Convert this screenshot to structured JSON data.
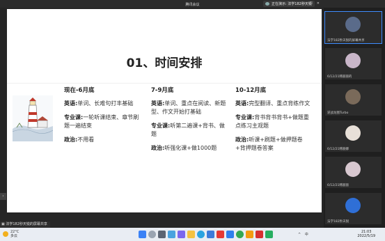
{
  "window": {
    "title": "腾讯会议",
    "sharing_status": "正在演示: 法学182秒天锐"
  },
  "slide": {
    "title": "01、时间安排",
    "columns": [
      {
        "head": "现在-6月底",
        "items": [
          {
            "label": "英语:",
            "text": "单词、长难句打丰基础"
          },
          {
            "label": "专业课:",
            "text": "一轮听课结束、章节刷题一遍结束"
          },
          {
            "label": "政治:",
            "text": "不用看"
          }
        ]
      },
      {
        "head": "7-9月底",
        "items": [
          {
            "label": "英语:",
            "text": "单词、重点在阅读、新题型、作文开始打基础"
          },
          {
            "label": "专业课:",
            "text": "听第二遍课+背书、做题"
          },
          {
            "label": "政治:",
            "text": "听强化课+做1000题"
          }
        ]
      },
      {
        "head": "10-12月底",
        "items": [
          {
            "label": "英语:",
            "text": "完型翻译、重点背练作文"
          },
          {
            "label": "专业课:",
            "text": "背书背书背书+做题重点练习主观题"
          },
          {
            "label": "政治:",
            "text": "听课+刷题+做押题卷+背押题卷答案"
          }
        ]
      }
    ]
  },
  "share_label": "法学182秒天锐的屏幕共享",
  "participants": [
    {
      "name": "法学182秒天锐的屏幕共享",
      "avatar_color": "#5a6b8a",
      "active": true
    },
    {
      "name": "6/12/21韩丽丽的",
      "avatar_color": "#c9b6c9",
      "active": false
    },
    {
      "name": "逆战龙图Turbo",
      "avatar_color": "#7a6a5a",
      "active": false
    },
    {
      "name": "6/12/21韩丽娜",
      "avatar_color": "#e8e0d8",
      "active": false
    },
    {
      "name": "6/12/21韩丽丽",
      "avatar_color": "#d8c8d0",
      "active": false
    },
    {
      "name": "法学182秒天锐",
      "avatar_color": "#2f6fd6",
      "active": false
    }
  ],
  "taskbar": {
    "weather_temp": "22°C",
    "weather_desc": "多云",
    "time": "21:03",
    "date": "2022/5/19",
    "tray_text": "^ 中"
  },
  "icons": {
    "taskbar_apps": [
      "windows-start",
      "search",
      "task-view",
      "widgets",
      "chat",
      "file-explorer",
      "edge",
      "store",
      "wps",
      "tencent-meeting",
      "chrome",
      "app-orange",
      "app-red",
      "app-green"
    ]
  }
}
